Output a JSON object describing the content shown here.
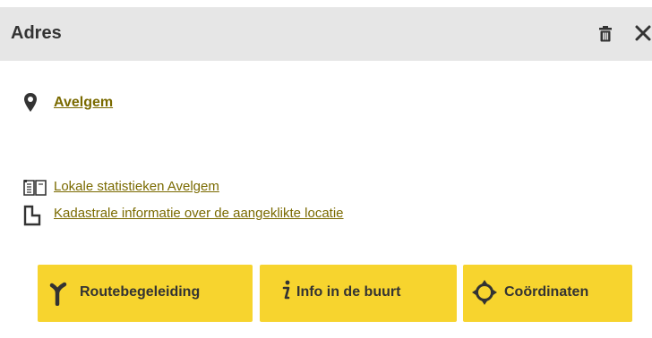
{
  "header": {
    "title": "Adres",
    "delete_icon": "trash-icon",
    "close_icon": "close-icon"
  },
  "location": {
    "icon": "map-pin-icon",
    "name": "Avelgem"
  },
  "links": [
    {
      "icon": "open-book-icon",
      "label": "Lokale statistieken Avelgem"
    },
    {
      "icon": "cadastral-parcel-icon",
      "label": "Kadastrale informatie over de aangeklikte locatie"
    }
  ],
  "buttons": [
    {
      "icon": "route-icon",
      "label": "Routebegeleiding"
    },
    {
      "icon": "info-icon",
      "label": "Info in de buurt"
    },
    {
      "icon": "crosshair-icon",
      "label": "Coördinaten"
    }
  ],
  "colors": {
    "header_bg": "#e6e6e6",
    "accent": "#f7d42e",
    "link": "#7a6a00",
    "text": "#333333"
  }
}
